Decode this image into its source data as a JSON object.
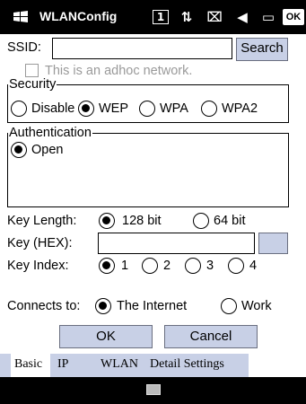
{
  "titlebar": {
    "title": "WLANConfig",
    "icons": [
      "one-icon",
      "connectivity-icon",
      "signal-icon",
      "speaker-icon",
      "battery-icon"
    ],
    "ok_label": "OK"
  },
  "ssid": {
    "label": "SSID:",
    "value": "",
    "search_label": "Search"
  },
  "adhoc": {
    "label": "This is an adhoc network.",
    "checked": false
  },
  "security": {
    "legend": "Security",
    "options": [
      "Disable",
      "WEP",
      "WPA",
      "WPA2"
    ],
    "selected": "WEP"
  },
  "authentication": {
    "legend": "Authentication",
    "options": [
      "Open"
    ],
    "selected": "Open"
  },
  "key_length": {
    "label": "Key Length:",
    "options": [
      "128 bit",
      "64 bit"
    ],
    "selected": "128 bit"
  },
  "key_hex": {
    "label": "Key (HEX):",
    "value": ""
  },
  "key_index": {
    "label": "Key Index:",
    "options": [
      "1",
      "2",
      "3",
      "4"
    ],
    "selected": "1"
  },
  "connects_to": {
    "label": "Connects to:",
    "options": [
      "The Internet",
      "Work"
    ],
    "selected": "The Internet"
  },
  "buttons": {
    "ok": "OK",
    "cancel": "Cancel"
  },
  "tabs": [
    "Basic",
    "IP",
    "WLAN",
    "Detail Settings"
  ],
  "active_tab": "Basic",
  "colors": {
    "accent": "#c8d0e6",
    "bar": "#000000"
  }
}
